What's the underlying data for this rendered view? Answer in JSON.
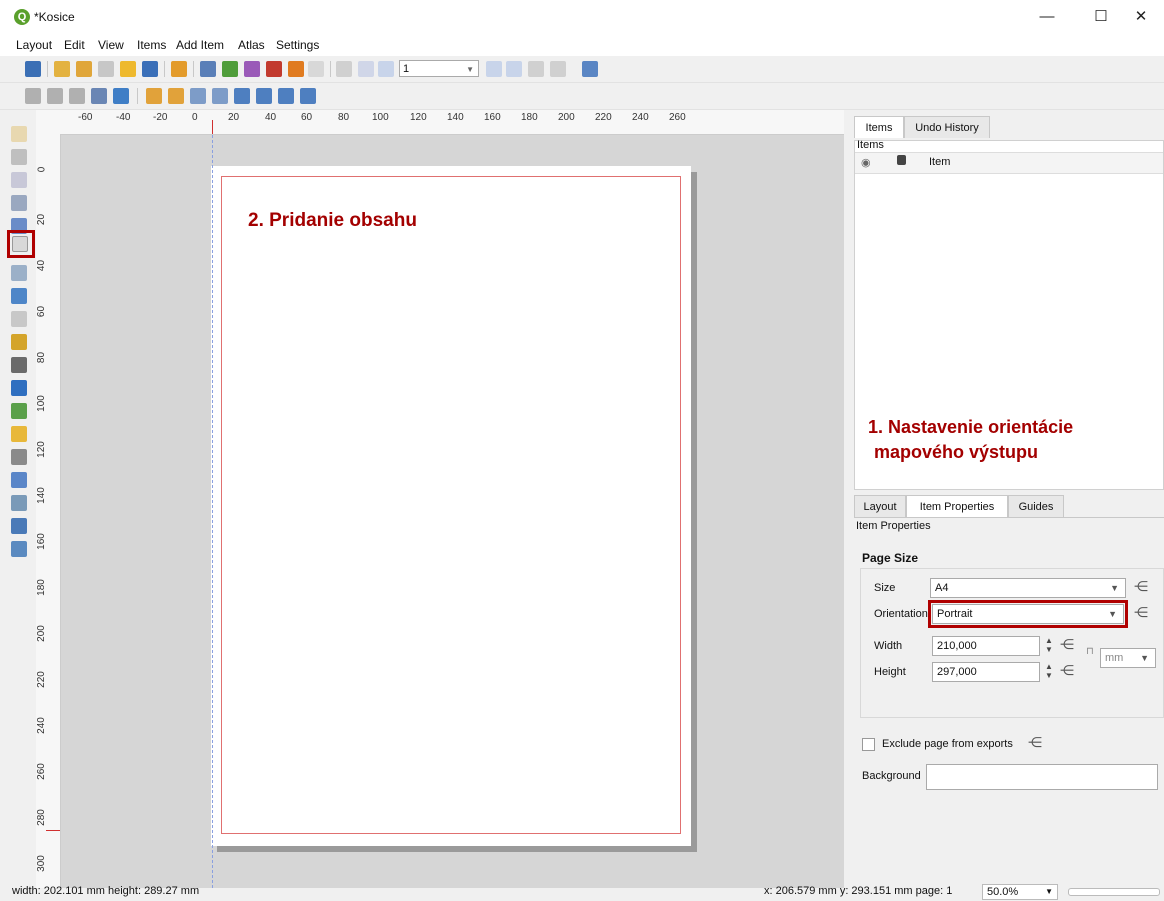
{
  "window": {
    "title": "*Kosice",
    "minimize": "—",
    "maximize": "☐",
    "close": "✕"
  },
  "menu": [
    "Layout",
    "Edit",
    "View",
    "Items",
    "Add Item",
    "Atlas",
    "Settings"
  ],
  "toolbar": {
    "page_number": "1"
  },
  "ruler": {
    "top_labels": [
      "-60",
      "-40",
      "-20",
      "0",
      "20",
      "40",
      "60",
      "80",
      "100",
      "120",
      "140",
      "160",
      "180",
      "200",
      "220",
      "240",
      "260"
    ],
    "left_labels": [
      "0",
      "20",
      "40",
      "60",
      "80",
      "100",
      "120",
      "140",
      "160",
      "180",
      "200",
      "220",
      "240",
      "260",
      "280",
      "300"
    ]
  },
  "canvas": {
    "annotation": "2. Pridanie obsahu"
  },
  "items_panel": {
    "tabs": [
      "Items",
      "Undo History"
    ],
    "title": "Items",
    "column_item": "Item"
  },
  "annotation_orientation": {
    "line1": "1. Nastavenie orientácie",
    "line2": "mapového výstupu"
  },
  "props_panel": {
    "tabs": [
      "Layout",
      "Item Properties",
      "Guides"
    ],
    "title": "Item Properties",
    "page_size_heading": "Page Size",
    "size_label": "Size",
    "size_value": "A4",
    "orientation_label": "Orientation",
    "orientation_value": "Portrait",
    "width_label": "Width",
    "width_value": "210,000",
    "height_label": "Height",
    "height_value": "297,000",
    "unit": "mm",
    "exclude_label": "Exclude page from exports",
    "background_label": "Background"
  },
  "status": {
    "size": "width: 202.101 mm height: 289.27 mm",
    "position": "x: 206.579 mm y: 293.151 mm page: 1",
    "zoom": "50.0%"
  },
  "colors": {
    "annotation": "#a30000",
    "highlight_box": "#b00000"
  }
}
